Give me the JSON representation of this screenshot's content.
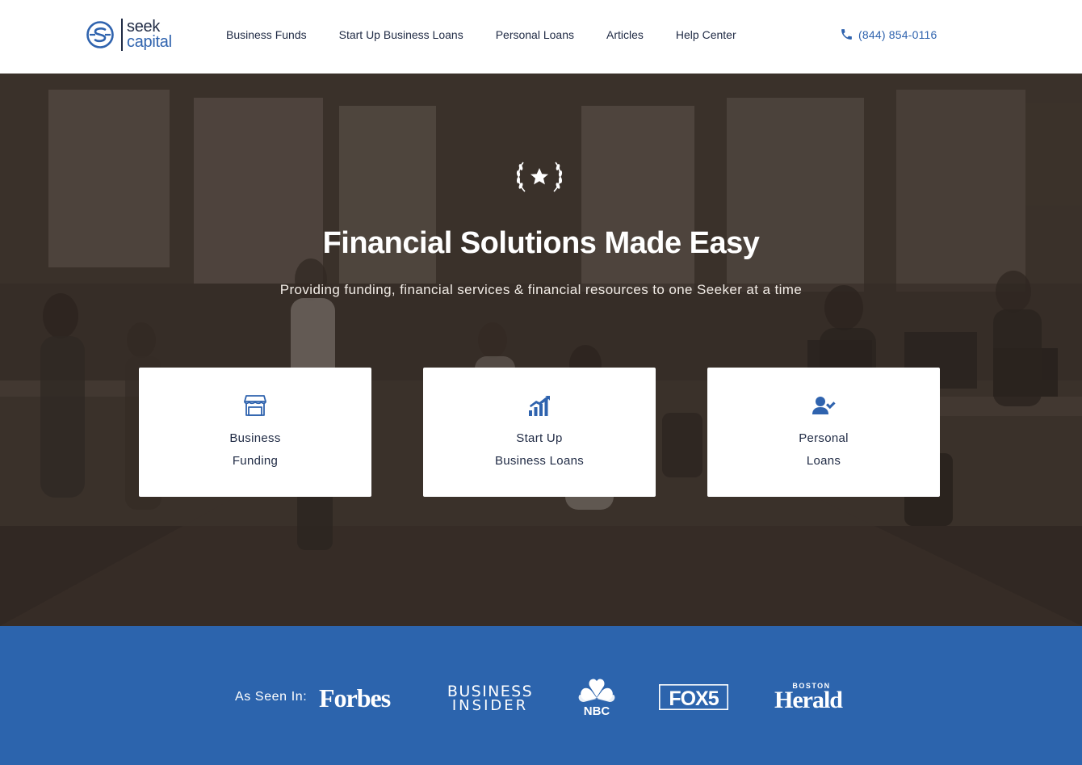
{
  "header": {
    "logo": {
      "line1": "seek",
      "line2": "capital",
      "icon": "seek-capital-s-mark"
    },
    "nav": [
      {
        "label": "Business Funds"
      },
      {
        "label": "Start Up Business Loans"
      },
      {
        "label": "Personal Loans"
      },
      {
        "label": "Articles"
      },
      {
        "label": "Help Center"
      }
    ],
    "phone": {
      "icon": "phone-icon",
      "number": "(844) 854-0116"
    }
  },
  "hero": {
    "badge_icon": "laurel-star-icon",
    "title": "Financial Solutions Made Easy",
    "subtitle": "Providing funding, financial services & financial resources to one Seeker at a time",
    "cards": [
      {
        "line1": "Business",
        "line2": "Funding",
        "icon": "storefront-icon"
      },
      {
        "line1": "Start Up",
        "line2": "Business Loans",
        "icon": "bar-chart-growth-icon"
      },
      {
        "line1": "Personal",
        "line2": "Loans",
        "icon": "user-check-icon"
      }
    ]
  },
  "press": {
    "label": "As Seen In:",
    "logos": {
      "forbes": "Forbes",
      "business_insider_line1": "BUSINESS",
      "business_insider_line2": "INSIDER",
      "nbc": "NBC",
      "fox5": "FOX5",
      "boston_herald_top": "BOSTON",
      "boston_herald_main": "Herald"
    }
  },
  "colors": {
    "brand_blue": "#2c64ad",
    "link_blue": "#2f63ae",
    "navy_text": "#1f2a44",
    "white": "#ffffff"
  }
}
